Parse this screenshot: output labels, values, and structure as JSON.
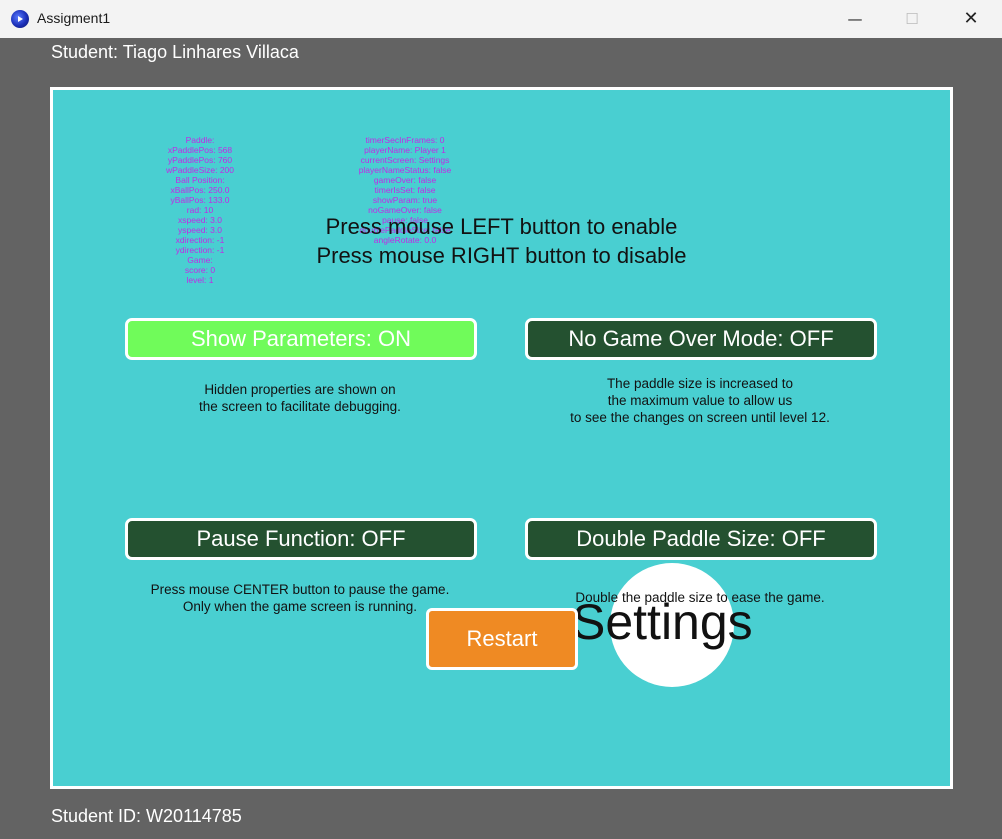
{
  "window": {
    "title": "Assigment1",
    "minimize_glyph": "—",
    "maximize_glyph": "☐",
    "close_glyph": "✕"
  },
  "header": {
    "student_name": "Student: Tiago Linhares Villaca"
  },
  "footer": {
    "student_id": "Student ID: W20114785"
  },
  "debug": {
    "column1": [
      "Paddle:",
      "xPaddlePos: 568",
      "yPaddlePos: 760",
      "wPaddleSize: 200",
      "Ball Position:",
      "xBallPos: 250.0",
      "yBallPos: 133.0",
      "rad: 10",
      "xspeed: 3.0",
      "yspeed: 3.0",
      "xdirection: -1",
      "ydirection: -1",
      "Game:",
      "score: 0",
      "level: 1"
    ],
    "column2": [
      "timerSecInFrames: 0",
      "playerName: Player 1",
      "currentScreen: Settings",
      "playerNameStatus: false",
      "gameOver: false",
      "timerIsSet: false",
      "showParam: true",
      "noGameOver: false",
      "pause: false",
      "doublePaddleSize: false",
      "angleRotate: 0.0"
    ]
  },
  "instructions": {
    "line1": "Press mouse LEFT button to enable",
    "line2": "Press mouse RIGHT button to disable"
  },
  "toggles": {
    "show_params": {
      "label": "Show Parameters: ON",
      "desc_line1": "Hidden properties are shown on",
      "desc_line2": "the screen to facilitate debugging."
    },
    "no_game_over": {
      "label": "No Game Over Mode: OFF",
      "desc_line1": "The paddle size is increased to",
      "desc_line2": "the maximum value to allow us",
      "desc_line3": "to see the changes on screen until level 12."
    },
    "pause": {
      "label": "Pause Function: OFF",
      "desc_line1": "Press mouse CENTER button to pause the game.",
      "desc_line2": "Only when the game screen is running."
    },
    "double_paddle": {
      "label": "Double Paddle Size: OFF",
      "desc_line1": "Double the paddle size to ease the game."
    }
  },
  "screen_title": "Settings",
  "restart_label": "Restart",
  "colors": {
    "canvas_bg": "#49cfd1",
    "button_on": "#70fb5a",
    "button_off": "#245130",
    "restart": "#ef8a23",
    "debug_text": "#c02ae6",
    "frame": "#636363"
  }
}
